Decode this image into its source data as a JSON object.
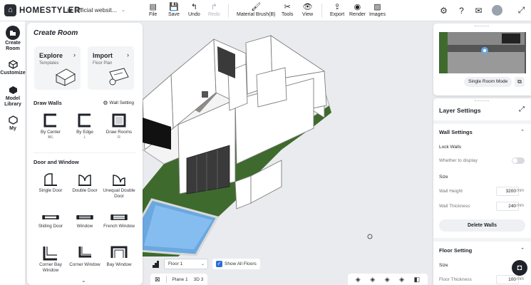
{
  "app": {
    "brand": "HOMESTYLER",
    "project_name": "Official websit..."
  },
  "toolbar": {
    "file": "File",
    "save": "Save",
    "undo": "Undo",
    "redo": "Redo",
    "material_brush": "Material Brush(B)",
    "tools": "Tools",
    "view": "View",
    "export": "Export",
    "render": "Render",
    "images": "Images"
  },
  "top_right_icons": [
    "settings-icon",
    "help-icon",
    "mail-icon",
    "user-avatar",
    "fullscreen-icon"
  ],
  "nav": {
    "create_room": "Create Room",
    "customize": "Customize",
    "model_library": "Model Library",
    "my": "My"
  },
  "panel": {
    "title": "Create Room",
    "explore": {
      "title": "Explore",
      "sub": "Templates"
    },
    "import": {
      "title": "Import",
      "sub": "Floor Plan"
    },
    "draw_walls": "Draw Walls",
    "wall_setting": "Wall Setting",
    "wall_tools": [
      {
        "label": "By Center",
        "shortcut": "⌘L"
      },
      {
        "label": "By Edge",
        "shortcut": "L"
      },
      {
        "label": "Draw Rooms",
        "shortcut": "R"
      }
    ],
    "door_window": "Door and Window",
    "dw_tools": [
      {
        "label": "Single Door"
      },
      {
        "label": "Double Door"
      },
      {
        "label": "Unequal Double Door"
      },
      {
        "label": "Sliding Door"
      },
      {
        "label": "Window"
      },
      {
        "label": "French Window"
      },
      {
        "label": "Corner Bay Window"
      },
      {
        "label": "Corner Window"
      },
      {
        "label": "Bay Window"
      }
    ]
  },
  "floorbar": {
    "floor": "Floor 1",
    "show_all_floors": "Show All Floors"
  },
  "viewbar": {
    "plane": "Plane",
    "plane_num": "1",
    "mode": "3D",
    "mode_num": "3"
  },
  "minimap": {
    "single_room_mode": "Single Room Mode"
  },
  "layer_settings": {
    "title": "Layer Settings",
    "wall_settings": "Wall Settings",
    "lock_walls": "Lock Walls",
    "whether_to_display": "Whether to display",
    "size": "Size",
    "wall_height_label": "Wall Height",
    "wall_height": "3200",
    "wall_thickness_label": "Wall Thickness",
    "wall_thickness": "240",
    "unit": "mm",
    "delete_walls": "Delete Walls",
    "floor_setting": "Floor Setting",
    "floor_size": "Size",
    "floor_thickness_label": "Floor Thickness",
    "floor_thickness": "100"
  },
  "colors": {
    "accent": "#2b6fd6",
    "grass": "#3e6b2c",
    "pool": "#7ab3e6",
    "dark": "#1f2329"
  }
}
